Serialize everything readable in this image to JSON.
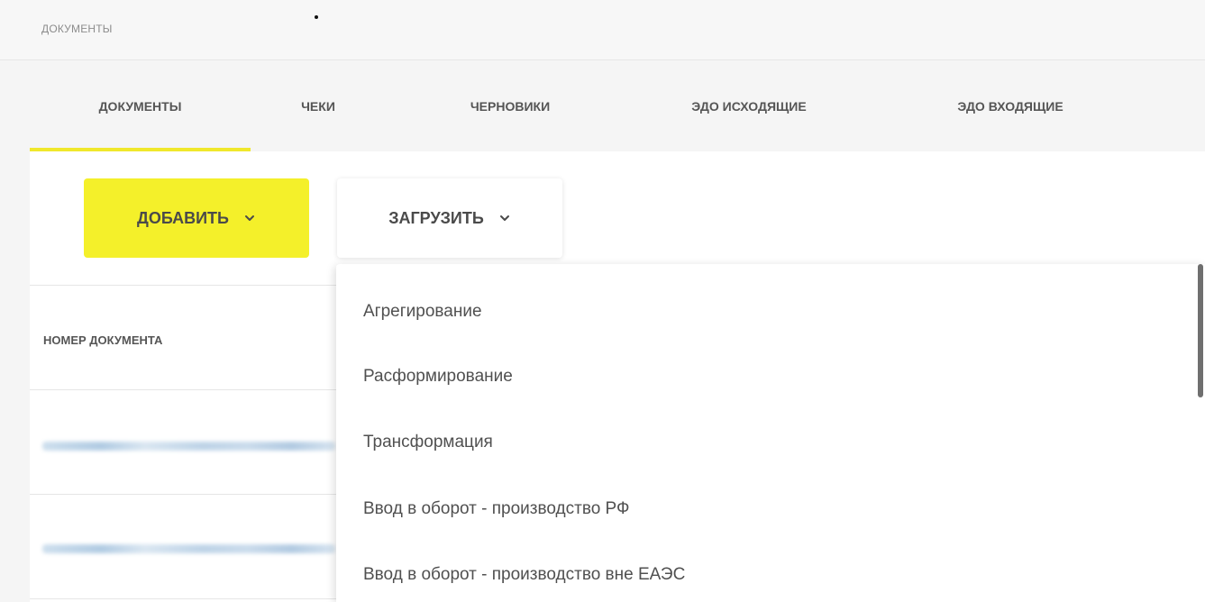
{
  "header": {
    "title": "ДОКУМЕНТЫ"
  },
  "tabs": [
    {
      "label": "ДОКУМЕНТЫ",
      "active": true
    },
    {
      "label": "ЧЕКИ",
      "active": false
    },
    {
      "label": "ЧЕРНОВИКИ",
      "active": false
    },
    {
      "label": "ЭДО ИСХОДЯЩИЕ",
      "active": false
    },
    {
      "label": "ЭДО ВХОДЯЩИЕ",
      "active": false
    }
  ],
  "toolbar": {
    "add_label": "ДОБАВИТЬ",
    "upload_label": "ЗАГРУЗИТЬ",
    "add_icon": "chevron-down-icon",
    "upload_icon": "chevron-down-icon"
  },
  "table": {
    "columns": [
      "НОМЕР ДОКУМЕНТА"
    ]
  },
  "upload_menu": {
    "items": [
      "Агрегирование",
      "Расформирование",
      "Трансформация",
      "Ввод в оборот - производство РФ",
      "Ввод в оборот - производство вне ЕАЭС"
    ]
  },
  "colors": {
    "accent": "#f4f02a",
    "tab_indicator": "#f0e82c",
    "text": "#555555"
  }
}
